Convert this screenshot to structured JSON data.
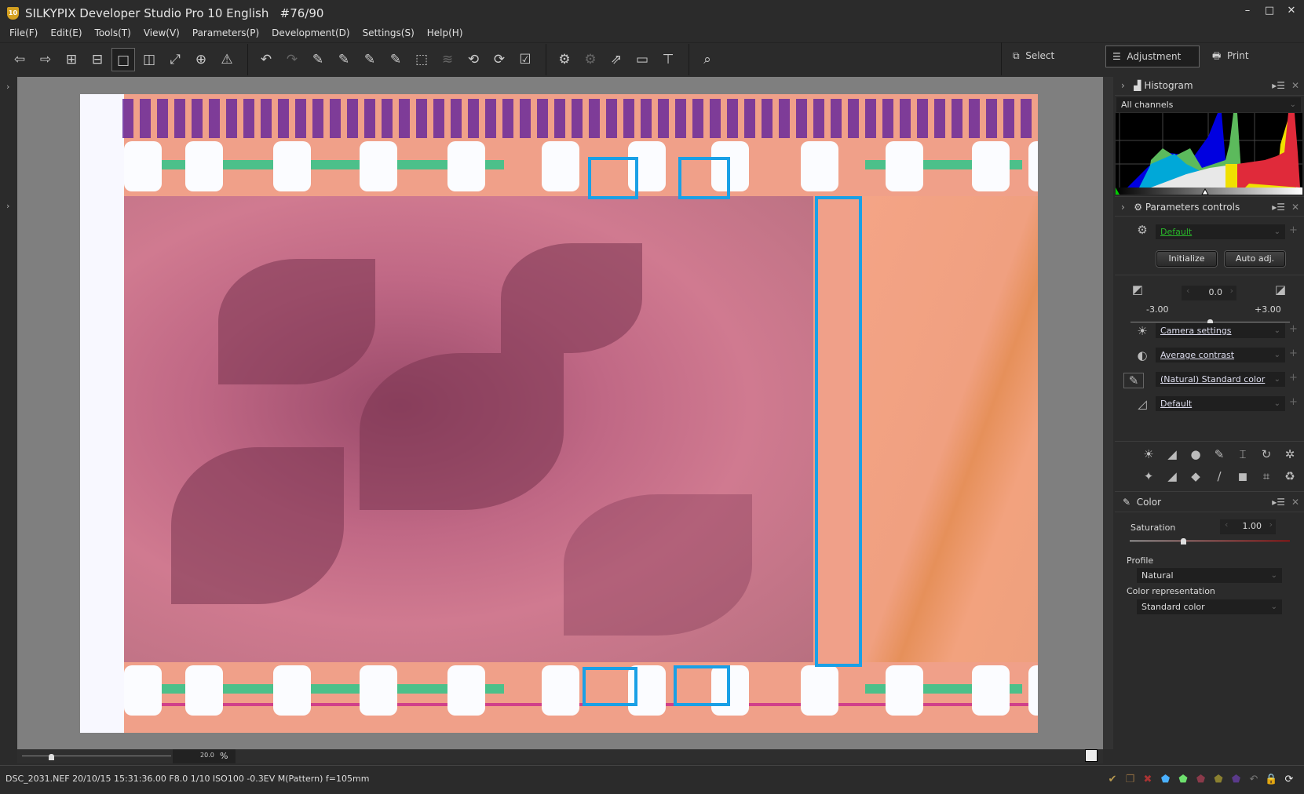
{
  "window": {
    "title": "SILKYPIX Developer Studio Pro 10 English   #76/90",
    "logo_text": "10",
    "controls": [
      "minimize",
      "maximize",
      "close"
    ]
  },
  "menu": [
    "File(F)",
    "Edit(E)",
    "Tools(T)",
    "View(V)",
    "Parameters(P)",
    "Development(D)",
    "Settings(S)",
    "Help(H)"
  ],
  "toolbar": {
    "group1": [
      "prev-photo",
      "next-photo",
      "thumbnail-grid",
      "thumbnail-strip",
      "single-view",
      "compare-view",
      "fullscreen",
      "grid-overlay",
      "warning"
    ],
    "group2": [
      "undo",
      "redo",
      "develop-paste",
      "develop-apply",
      "develop-batch",
      "develop-tone",
      "transform-points",
      "layers",
      "rotate-left",
      "rotate-right",
      "check"
    ],
    "group3": [
      "develop-settings",
      "develop-settings-dim",
      "export",
      "display",
      "hammer"
    ],
    "group4": [
      "loupe"
    ],
    "modes": [
      {
        "label": "Select",
        "icon": "select-icon"
      },
      {
        "label": "Adjustment",
        "icon": "sliders-icon",
        "active": true
      },
      {
        "label": "Print",
        "icon": "printer-icon"
      }
    ]
  },
  "viewer": {
    "zoom_value": "20.0",
    "zoom_unit": "%",
    "accent_box_color": "#1aa0e6"
  },
  "panel": {
    "histogram": {
      "title": "Histogram",
      "channel": "All channels"
    },
    "parameters": {
      "title": "Parameters controls",
      "preset": "Default",
      "initialize": "Initialize",
      "auto_adj": "Auto adj.",
      "exposure_value": "0.0",
      "exposure_min": "-3.00",
      "exposure_max": "+3.00",
      "exposure_level": 0.0,
      "rows": [
        {
          "icon": "white-balance-icon",
          "value": "Camera settings"
        },
        {
          "icon": "contrast-icon",
          "value": "Average contrast"
        },
        {
          "icon": "color-icon",
          "value": "(Natural) Standard color"
        },
        {
          "icon": "sharpness-icon",
          "value": "Default"
        }
      ],
      "tools": [
        "highlight",
        "tone-curve",
        "noise",
        "color-tool",
        "lens",
        "rotate",
        "develop-options",
        "dodge",
        "gradation",
        "fish-eye",
        "brush",
        "composite",
        "crop",
        "recycle"
      ]
    },
    "color": {
      "title": "Color",
      "saturation_label": "Saturation",
      "saturation_value": "1.00",
      "saturation_level": 1.0,
      "profile_label": "Profile",
      "profile": "Natural",
      "repr_label": "Color representation",
      "repr": "Standard color"
    }
  },
  "status": {
    "text": "DSC_2031.NEF 20/10/15 15:31:36.00 F8.0 1/10 ISO100 -0.3EV M(Pattern) f=105mm",
    "icons": [
      {
        "name": "check",
        "color": "#b89a50",
        "g": "✔"
      },
      {
        "name": "copy",
        "color": "#8a6a40",
        "g": "❐"
      },
      {
        "name": "reject",
        "color": "#a33",
        "g": "✖"
      },
      {
        "name": "tag-blue",
        "color": "#4ab0ff",
        "g": "⬟"
      },
      {
        "name": "tag-green",
        "color": "#6ee06e",
        "g": "⬟"
      },
      {
        "name": "tag-red",
        "color": "#8a3a4a",
        "g": "⬟"
      },
      {
        "name": "tag-yellow",
        "color": "#8a8030",
        "g": "⬟"
      },
      {
        "name": "tag-purple",
        "color": "#5a3a8a",
        "g": "⬟"
      },
      {
        "name": "revert",
        "color": "#777",
        "g": "↶"
      },
      {
        "name": "lock",
        "color": "#777",
        "g": "🔒"
      },
      {
        "name": "sync",
        "color": "#eee",
        "g": "⟳"
      }
    ]
  }
}
